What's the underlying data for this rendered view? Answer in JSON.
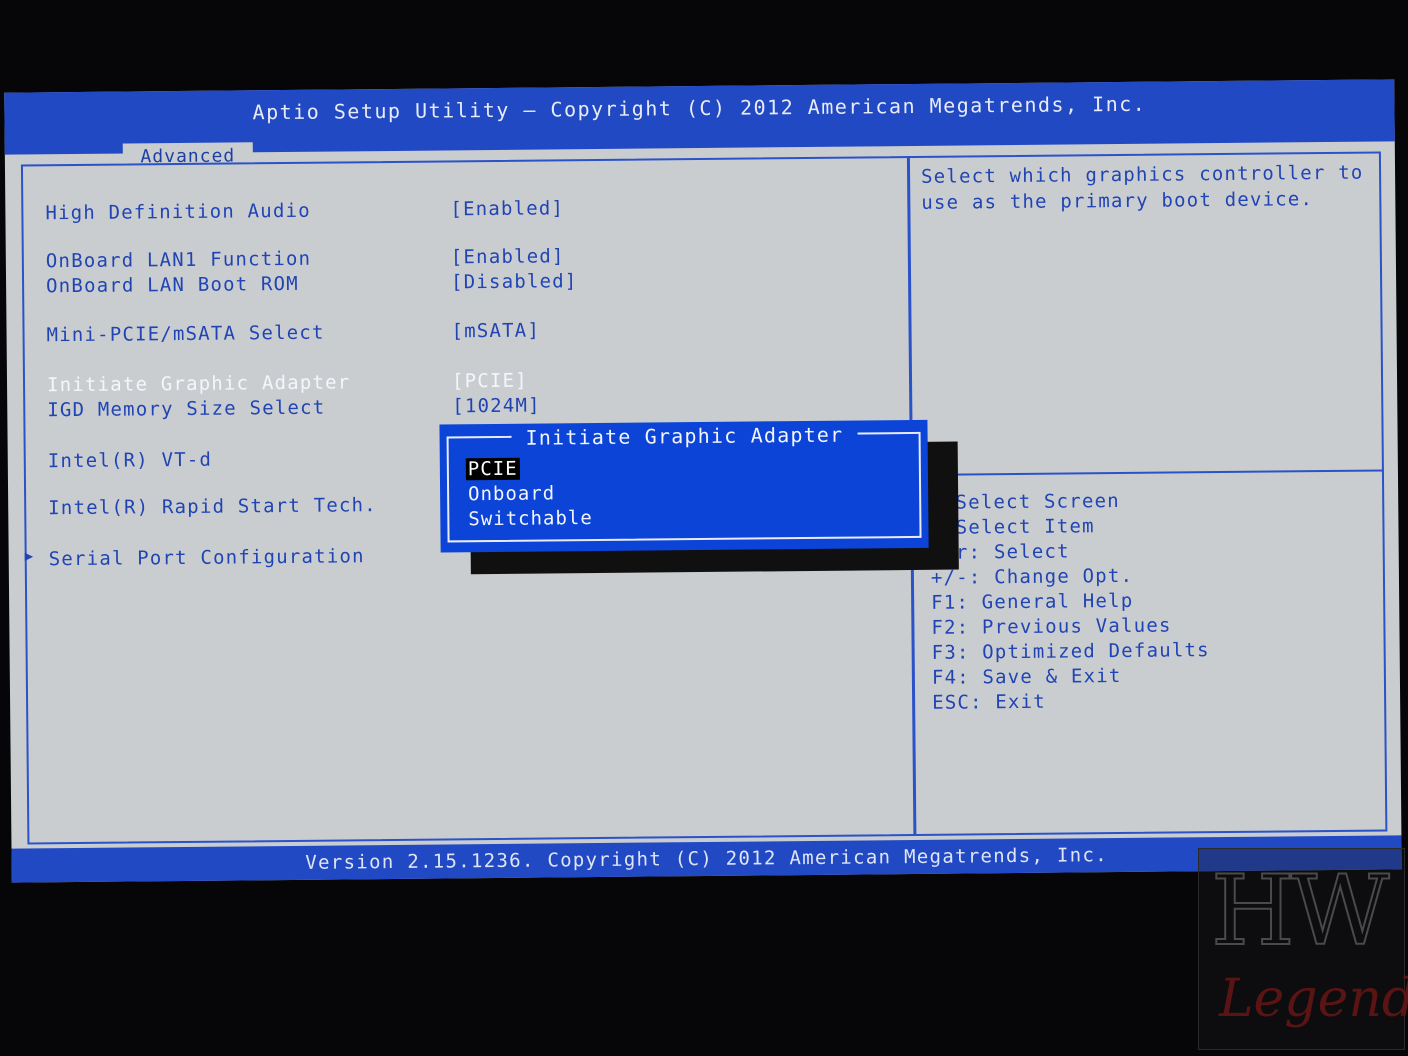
{
  "header": {
    "title": "Aptio Setup Utility – Copyright (C) 2012 American Megatrends, Inc.",
    "active_tab": "Advanced"
  },
  "settings": [
    {
      "label": "High Definition Audio",
      "value": "[Enabled]"
    },
    {
      "label": "OnBoard LAN1 Function",
      "value": "[Enabled]"
    },
    {
      "label": "OnBoard LAN Boot ROM",
      "value": "[Disabled]"
    },
    {
      "label": "Mini-PCIE/mSATA Select",
      "value": "[mSATA]"
    },
    {
      "label": "Initiate Graphic Adapter",
      "value": "[PCIE]"
    },
    {
      "label": "IGD Memory Size Select",
      "value": "[1024M]"
    },
    {
      "label": "Intel(R) VT-d",
      "value": ""
    },
    {
      "label": "Intel(R) Rapid Start Tech.",
      "value": ""
    },
    {
      "label": "Serial Port Configuration",
      "value": ""
    }
  ],
  "help": {
    "text": "Select which graphics controller to use as the primary boot device."
  },
  "keys": [
    ": Select Screen",
    ": Select Item",
    "ter: Select",
    "+/-: Change Opt.",
    "F1: General Help",
    "F2: Previous Values",
    "F3: Optimized Defaults",
    "F4: Save & Exit",
    "ESC: Exit"
  ],
  "popup": {
    "title": "Initiate Graphic Adapter",
    "options": [
      "PCIE",
      "Onboard",
      "Switchable"
    ],
    "selected": "PCIE"
  },
  "footer": {
    "text": "Version 2.15.1236. Copyright (C) 2012 American Megatrends, Inc."
  },
  "watermark": {
    "line1": "HW",
    "line2": "Legend"
  },
  "colors": {
    "bios_blue": "#2249c4",
    "bios_gray": "#c9cdd0",
    "popup_blue": "#0b44d6"
  }
}
